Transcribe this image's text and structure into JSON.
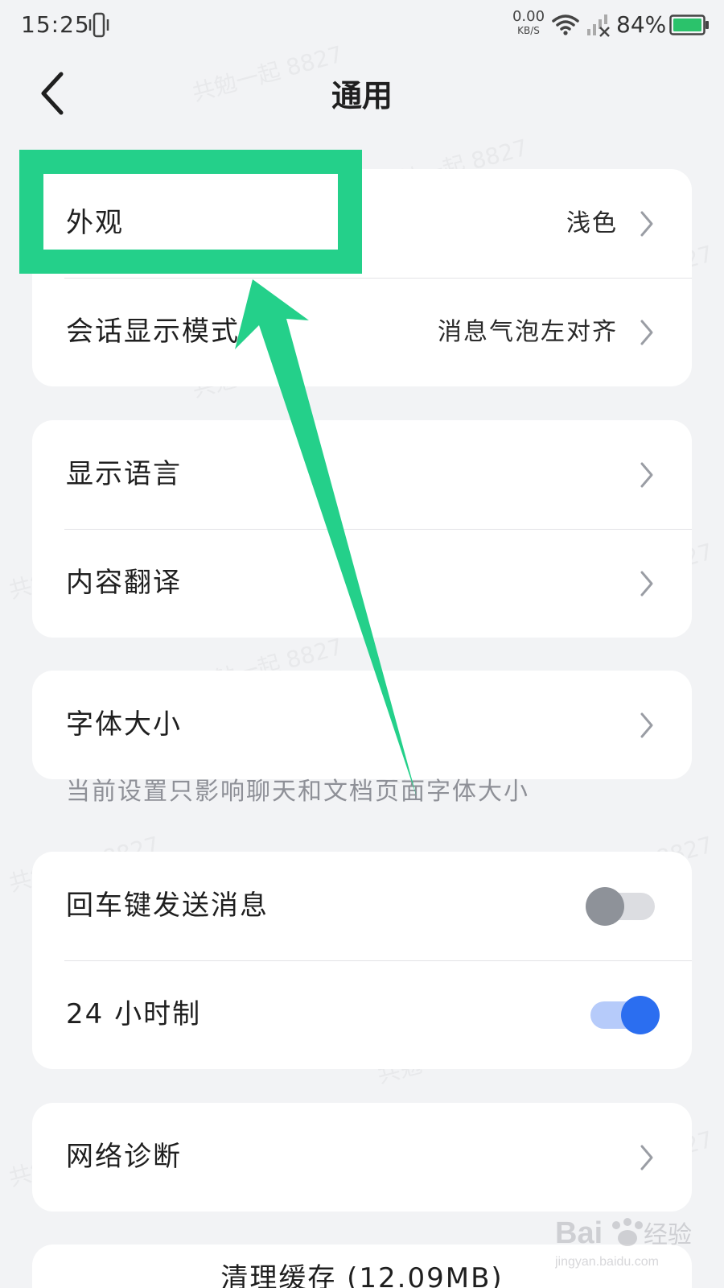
{
  "status_bar": {
    "time": "15:25",
    "net_speed_value": "0.00",
    "net_speed_unit": "KB/S",
    "battery_percent": "84%",
    "icons": [
      "vibrate-icon",
      "wifi-icon",
      "signal-no-sim-icon",
      "battery-icon"
    ]
  },
  "header": {
    "title": "通用",
    "back_icon": "chevron-left-icon"
  },
  "groups": [
    {
      "rows": [
        {
          "label": "外观",
          "value": "浅色",
          "type": "chevron"
        },
        {
          "label": "会话显示模式",
          "value": "消息气泡左对齐",
          "type": "chevron"
        }
      ]
    },
    {
      "rows": [
        {
          "label": "显示语言",
          "value": "",
          "type": "chevron"
        },
        {
          "label": "内容翻译",
          "value": "",
          "type": "chevron"
        }
      ]
    },
    {
      "rows": [
        {
          "label": "字体大小",
          "value": "",
          "type": "chevron"
        }
      ],
      "footer_hint": "当前设置只影响聊天和文档页面字体大小"
    },
    {
      "rows": [
        {
          "label": "回车键发送消息",
          "type": "toggle",
          "on": false
        },
        {
          "label": "24 小时制",
          "type": "toggle",
          "on": true
        }
      ]
    },
    {
      "rows": [
        {
          "label": "网络诊断",
          "value": "",
          "type": "chevron"
        }
      ]
    },
    {
      "rows": [
        {
          "label": "清理缓存 (12.09MB)",
          "type": "action"
        }
      ]
    }
  ],
  "watermark_text": "共勉一起 8827",
  "annotation": {
    "highlight_color": "#24d08a",
    "target": "外观"
  },
  "logo": {
    "brand": "Baidu经验",
    "url_text": "jingyan.baidu.com"
  },
  "colors": {
    "background": "#f2f3f5",
    "card": "#ffffff",
    "toggle_on": "#2b6ef0",
    "toggle_on_track": "#b6cbfa",
    "toggle_off_knob": "#8e9299",
    "toggle_off_track": "#dcdde1"
  }
}
